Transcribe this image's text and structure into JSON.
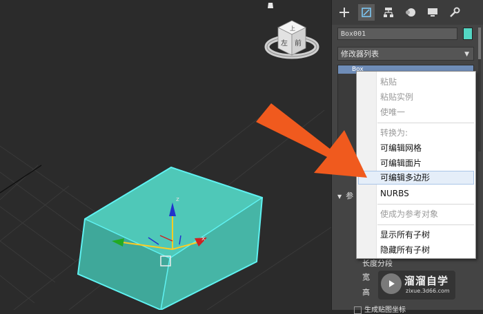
{
  "colors": {
    "box_fill": "#4fc8b8",
    "box_edge": "#5ff2f2",
    "arrow": "#f05a1e",
    "menu_highlight": "#e5eef9",
    "object_color": "#53d6c3"
  },
  "viewcube": {
    "top_label": "上",
    "left_label": "左",
    "front_label": "前"
  },
  "gizmo": {
    "z_label": "z",
    "x_label": "x"
  },
  "command_panel": {
    "tabs": [
      {
        "name": "create",
        "icon": "plus-icon"
      },
      {
        "name": "modify",
        "icon": "modify-icon"
      },
      {
        "name": "hierarchy",
        "icon": "hierarchy-icon"
      },
      {
        "name": "motion",
        "icon": "motion-icon"
      },
      {
        "name": "display",
        "icon": "display-icon"
      },
      {
        "name": "utilities",
        "icon": "wrench-icon"
      }
    ],
    "object_name": "Box001",
    "modifier_list_label": "修改器列表",
    "stack_item": "Box",
    "rollout_title": "参",
    "params": {
      "length_segs": "长度分段",
      "width": "宽",
      "height": "高"
    },
    "checkbox_label": "生成贴图坐标"
  },
  "context_menu": {
    "items": [
      {
        "label": "粘贴",
        "enabled": false
      },
      {
        "label": "粘贴实例",
        "enabled": false
      },
      {
        "label": "使唯一",
        "enabled": false
      },
      {
        "label": "转换为:",
        "enabled": false
      },
      {
        "label": "可编辑网格",
        "enabled": true
      },
      {
        "label": "可编辑面片",
        "enabled": true
      },
      {
        "label": "可编辑多边形",
        "enabled": true,
        "highlighted": true
      },
      {
        "label": "NURBS",
        "enabled": true
      },
      {
        "label": "使成为参考对象",
        "enabled": false
      },
      {
        "label": "显示所有子树",
        "enabled": true
      },
      {
        "label": "隐藏所有子树",
        "enabled": true
      }
    ]
  },
  "watermark": {
    "title": "溜溜自学",
    "subtitle": "zixue.3d66.com"
  }
}
